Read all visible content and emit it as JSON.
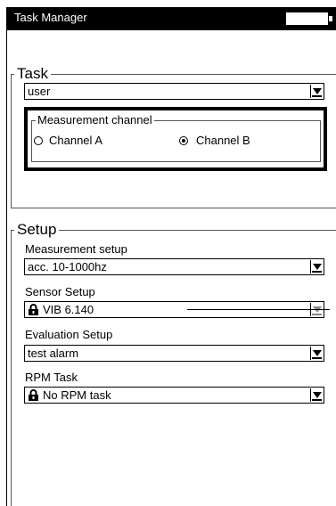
{
  "window": {
    "title": "Task Manager"
  },
  "task_group": {
    "label": "Task",
    "task_value": "user",
    "measurement_channel": {
      "label": "Measurement channel",
      "options": [
        {
          "label": "Channel A",
          "selected": false
        },
        {
          "label": "Channel B",
          "selected": true
        }
      ]
    }
  },
  "setup_group": {
    "label": "Setup",
    "measurement_setup": {
      "label": "Measurement setup",
      "value": "acc. 10-1000hz"
    },
    "sensor_setup": {
      "label": "Sensor Setup",
      "value": "VIB 6.140",
      "locked": true,
      "disabled": true
    },
    "evaluation_setup": {
      "label": "Evaluation Setup",
      "value": "test alarm"
    },
    "rpm_task": {
      "label": "RPM Task",
      "value": "No RPM task",
      "locked": true
    }
  },
  "icons": {
    "dropdown": "chevron-down-icon",
    "lock": "lock-icon",
    "battery": "battery-icon"
  }
}
